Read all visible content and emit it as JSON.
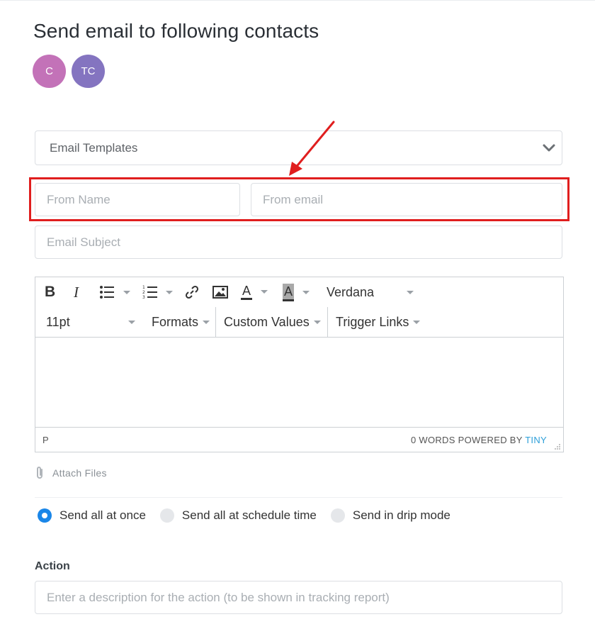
{
  "page": {
    "title": "Send email to following contacts"
  },
  "contacts": [
    {
      "initials": "C",
      "color": "#c372b8"
    },
    {
      "initials": "TC",
      "color": "#8474c0"
    }
  ],
  "form": {
    "templates_label": "Email Templates",
    "from_name_placeholder": "From Name",
    "from_email_placeholder": "From email",
    "subject_placeholder": "Email Subject",
    "highlight_color": "#e01e1e"
  },
  "editor": {
    "bold_label": "B",
    "italic_label": "I",
    "font_family": "Verdana",
    "font_size": "11pt",
    "formats_label": "Formats",
    "custom_values_label": "Custom Values",
    "trigger_links_label": "Trigger Links",
    "text_color_label": "A",
    "bg_color_label": "A",
    "status_path": "P",
    "words_text": "0 WORDS POWERED BY ",
    "brand": "TINY"
  },
  "attach": {
    "label": "Attach Files"
  },
  "send_mode": {
    "options": [
      {
        "label": "Send all at once",
        "selected": true
      },
      {
        "label": "Send all at schedule time",
        "selected": false
      },
      {
        "label": "Send in drip mode",
        "selected": false
      }
    ]
  },
  "action": {
    "label": "Action",
    "placeholder": "Enter a description for the action (to be shown in tracking report)"
  }
}
